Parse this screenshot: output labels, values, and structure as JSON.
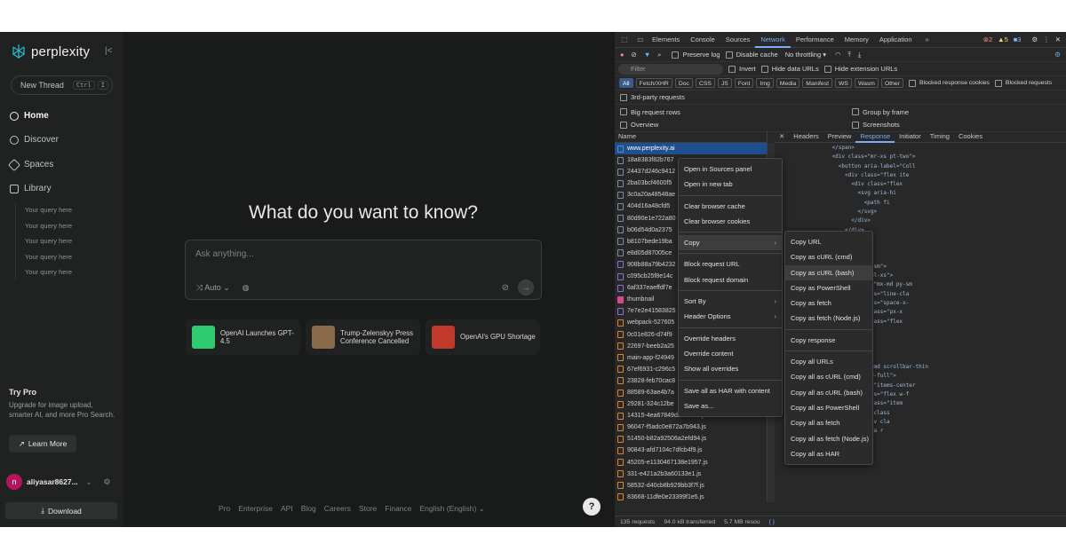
{
  "sidebar": {
    "brand": "perplexity",
    "new_thread": "New Thread",
    "kbd": [
      "Ctrl",
      "I"
    ],
    "nav": [
      "Home",
      "Discover",
      "Spaces",
      "Library"
    ],
    "library_items": [
      "Your query here",
      "Your query here",
      "Your query here",
      "Your query here",
      "Your query here"
    ],
    "try_pro_title": "Try Pro",
    "try_pro_desc": "Upgrade for image upload, smarter AI, and more Pro Search.",
    "learn_more": "Learn More",
    "user_initial": "n",
    "username": "aliyasar8627...",
    "download": "Download"
  },
  "main": {
    "hero": "What do you want to know?",
    "placeholder": "Ask anything...",
    "mode": "Auto",
    "cards": [
      {
        "title": "OpenAI Launches GPT-4.5",
        "color": "#2ecc71"
      },
      {
        "title": "Trump-Zelenskyy Press Conference Cancelled",
        "color": "#8a6a4a"
      },
      {
        "title": "OpenAI's GPU Shortage",
        "color": "#c0392b"
      }
    ],
    "footer": [
      "Pro",
      "Enterprise",
      "API",
      "Blog",
      "Careers",
      "Store",
      "Finance",
      "English (English)"
    ],
    "help": "?"
  },
  "devtools": {
    "tabs": [
      "Elements",
      "Console",
      "Sources",
      "Network",
      "Performance",
      "Memory",
      "Application"
    ],
    "active_tab": "Network",
    "errors": "2",
    "warnings": "5",
    "infos": "3",
    "toolbar": {
      "preserve_log": "Preserve log",
      "disable_cache": "Disable cache",
      "throttle": "No throttling"
    },
    "filter_placeholder": "Filter",
    "invert": "Invert",
    "hide_data": "Hide data URLs",
    "hide_ext": "Hide extension URLs",
    "chips": [
      "All",
      "Fetch/XHR",
      "Doc",
      "CSS",
      "JS",
      "Font",
      "Img",
      "Media",
      "Manifest",
      "WS",
      "Wasm",
      "Other"
    ],
    "blocked_cookies": "Blocked response cookies",
    "blocked_requests": "Blocked requests",
    "third_party": "3rd-party requests",
    "big_rows": "Big request rows",
    "group_frame": "Group by frame",
    "overview": "Overview",
    "screenshots": "Screenshots",
    "name_header": "Name",
    "requests": [
      {
        "name": "www.perplexity.ai",
        "kind": "doc"
      },
      {
        "name": "18a8383f82b767",
        "kind": "fetch"
      },
      {
        "name": "24437d246c9412",
        "kind": "fetch"
      },
      {
        "name": "2ba03bcf4600f5",
        "kind": "fetch"
      },
      {
        "name": "3c0a20a48548ae",
        "kind": "fetch"
      },
      {
        "name": "404d16a48cfd5",
        "kind": "fetch"
      },
      {
        "name": "80d90e1e722a80",
        "kind": "fetch"
      },
      {
        "name": "b06d54d0a2375",
        "kind": "fetch"
      },
      {
        "name": "b8107bede19ba",
        "kind": "fetch"
      },
      {
        "name": "e8d05d87005ce",
        "kind": "fetch"
      },
      {
        "name": "908b88a79b4232",
        "kind": "css"
      },
      {
        "name": "c095cb25f8e14c",
        "kind": "css"
      },
      {
        "name": "6af337eaeffdf7e",
        "kind": "css"
      },
      {
        "name": "thumbnail",
        "kind": "img"
      },
      {
        "name": "7e7e2e41583825",
        "kind": "css"
      },
      {
        "name": "webpack-527605",
        "kind": "js"
      },
      {
        "name": "0c01e826-d74f9",
        "kind": "js"
      },
      {
        "name": "22697-beeb2a25",
        "kind": "js"
      },
      {
        "name": "main-app-f24949",
        "kind": "js"
      },
      {
        "name": "67ef6931-c296c5",
        "kind": "js"
      },
      {
        "name": "23828-feb70cac8",
        "kind": "js"
      },
      {
        "name": "88589-63ae4b7a",
        "kind": "js"
      },
      {
        "name": "29281-324c12be",
        "kind": "js"
      },
      {
        "name": "14315-4ea67849dbd7278f.js",
        "kind": "js"
      },
      {
        "name": "96047-f5adc0e872a7b943.js",
        "kind": "js"
      },
      {
        "name": "51450-b82a92506a2efd94.js",
        "kind": "js"
      },
      {
        "name": "90843-afd7104c7dfcb4f9.js",
        "kind": "js"
      },
      {
        "name": "45205-e1130467138e1957.js",
        "kind": "js"
      },
      {
        "name": "331-e421a2b3a60133e1.js",
        "kind": "js"
      },
      {
        "name": "58532-d40cb8b929bb3f7f.js",
        "kind": "js"
      },
      {
        "name": "83668-11dfe0e23399f1e5.js",
        "kind": "js"
      }
    ],
    "resp_tabs": [
      "Headers",
      "Preview",
      "Response",
      "Initiator",
      "Timing",
      "Cookies"
    ],
    "resp_active": "Response",
    "code": [
      "              </span>",
      "              <div class=\"mr-xs pt-two\">",
      "                <button aria-label=\"Coll",
      "                  <div class=\"flex ite",
      "                    <div class=\"flex",
      "                      <svg aria-hi",
      "                        <path fi",
      "                      </svg>",
      "                    </div>",
      "                  </div>",
      "                </button>",
      "              </div>",
      "            </div>",
      "            <div class=\"pt-sm\">",
      "              <div class=\"ml-xs\">",
      "                <div class=\"mx-md py-sm",
      "                  <div class=\"line-cla",
      "                  <div class=\"space-x-",
      "                    <div class=\"px-x",
      "                    <div class=\"flex",
      "                  </div>",
      "                </div>",
      "              </div>",
      "            </div>",
      "            <div class=\"pt-md scrollbar-thin",
      "              <div class=\"w-full\">",
      "                <div class=\"items-center",
      "                  <div class=\"flex w-f",
      "                    <div class=\"item",
      "                      <div class",
      "                        <div cla",
      "                          <a r",
      "",
      "",
      "",
      "",
      "",
      "",
      ""
    ],
    "status": {
      "requests": "135 requests",
      "transferred": "94.0 kB transferred",
      "resources": "5.7 MB resou"
    },
    "context_menu": [
      "Open in Sources panel",
      "Open in new tab",
      "|",
      "Clear browser cache",
      "Clear browser cookies",
      "|",
      "Copy",
      "|",
      "Block request URL",
      "Block request domain",
      "|",
      "Sort By",
      "Header Options",
      "|",
      "Override headers",
      "Override content",
      "Show all overrides",
      "|",
      "Save all as HAR with content",
      "Save as..."
    ],
    "copy_menu": [
      "Copy URL",
      "Copy as cURL (cmd)",
      "Copy as cURL (bash)",
      "Copy as PowerShell",
      "Copy as fetch",
      "Copy as fetch (Node.js)",
      "|",
      "Copy response",
      "|",
      "Copy all URLs",
      "Copy all as cURL (cmd)",
      "Copy all as cURL (bash)",
      "Copy all as PowerShell",
      "Copy all as fetch",
      "Copy all as fetch (Node.js)",
      "Copy all as HAR"
    ],
    "menu_highlight": "Copy",
    "submenu_highlight": "Copy as cURL (bash)"
  },
  "colors": {
    "accent": "#7cacf8",
    "selected_row": "#1f4f8f",
    "error": "#f28b82",
    "warning": "#fdd663"
  }
}
